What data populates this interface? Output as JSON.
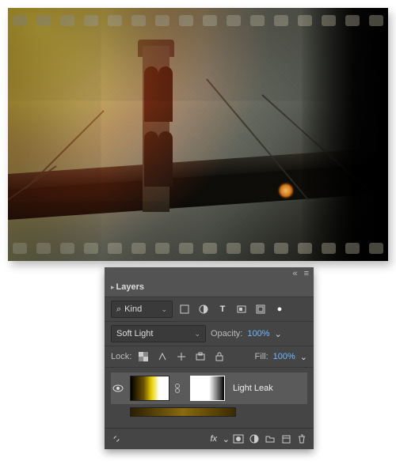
{
  "panel": {
    "title": "Layers",
    "collapse_glyph": "«",
    "menu_glyph": "≡",
    "filter": {
      "search_glyph": "⌕",
      "mode": "Kind"
    },
    "blend_mode": "Soft Light",
    "opacity_label": "Opacity:",
    "opacity_value": "100%",
    "lock_label": "Lock:",
    "fill_label": "Fill:",
    "fill_value": "100%",
    "layers": [
      {
        "name": "Light Leak",
        "visible": true,
        "linked": true
      }
    ]
  },
  "icons": {
    "chev": "⌄",
    "eye": "👁",
    "link_chain": "⛓",
    "link_paper": "⎘",
    "fx": "fx",
    "dot": "●"
  }
}
